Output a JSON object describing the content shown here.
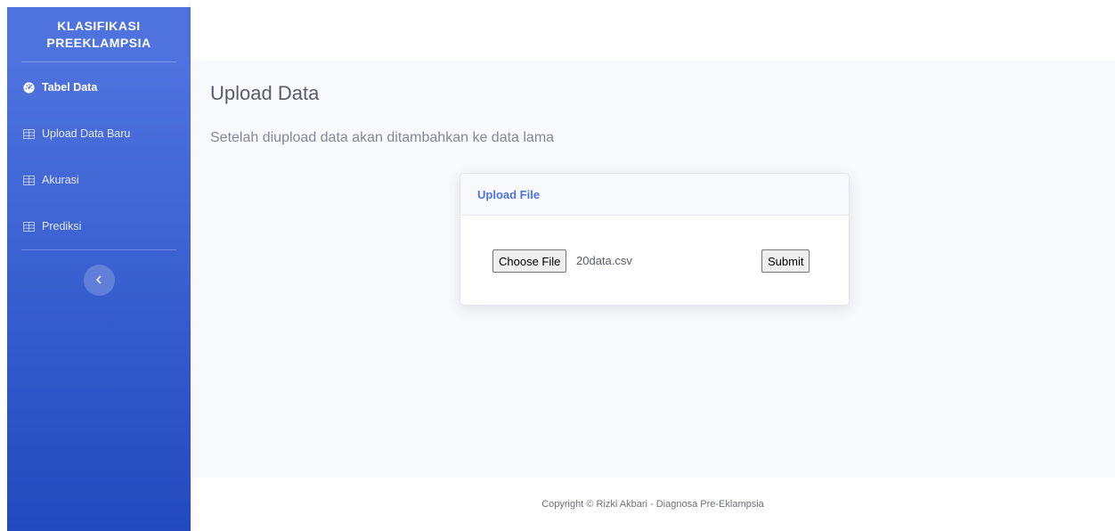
{
  "sidebar": {
    "brand_line1": "KLASIFIKASI",
    "brand_line2": "PREEKLAMPSIA",
    "items": [
      {
        "label": "Tabel Data",
        "icon": "tachometer-icon",
        "active": true
      },
      {
        "label": "Upload Data Baru",
        "icon": "table-icon",
        "active": false
      },
      {
        "label": "Akurasi",
        "icon": "table-icon",
        "active": false
      },
      {
        "label": "Prediksi",
        "icon": "table-icon",
        "active": false
      }
    ],
    "toggle_icon": "chevron-left-icon",
    "gradient_top": "#4e73df",
    "gradient_bottom": "#224abe"
  },
  "main": {
    "title": "Upload Data",
    "subtitle": "Setelah diupload data akan ditambahkan ke data lama"
  },
  "card": {
    "header": "Upload File",
    "choose_label": "Choose File",
    "file_name": "20data.csv",
    "submit_label": "Submit",
    "accent": "#4e73df"
  },
  "footer": {
    "text": "Copyright © Rizki Akbari - Diagnosa Pre-Eklampsia"
  }
}
